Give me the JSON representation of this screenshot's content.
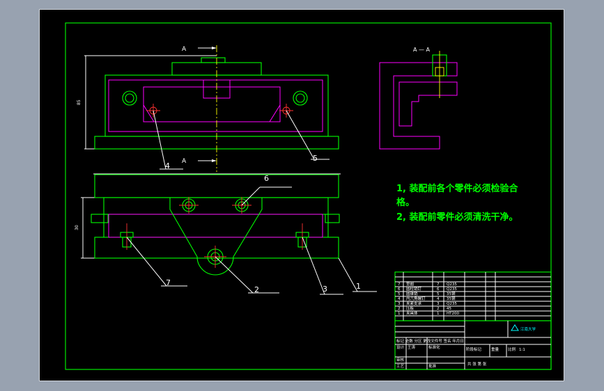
{
  "section_markers": {
    "top": "A",
    "bottom": "A"
  },
  "section_view_title": "A — A",
  "part_callouts": [
    "1",
    "2",
    "3",
    "4",
    "5",
    "6",
    "7"
  ],
  "dimension_labels": {
    "height_top": "85",
    "height_front": "30"
  },
  "technical_notes": [
    "1, 装配前各个零件必须检验合",
    "格。",
    "2, 装配前零件必须清洗干净。"
  ],
  "bom": {
    "rows": [
      {
        "no": "7",
        "name": "垫圈",
        "qty": "7",
        "material": "Q235"
      },
      {
        "no": "6",
        "name": "圆柱销钉",
        "qty": "6",
        "material": "Q235"
      },
      {
        "no": "5",
        "name": "圆锥销",
        "qty": "5",
        "material": "35钢"
      },
      {
        "no": "4",
        "name": "内六角螺钉",
        "qty": "4",
        "material": "35钢"
      },
      {
        "no": "3",
        "name": "夹紧支承",
        "qty": "3",
        "material": "Q235"
      },
      {
        "no": "2",
        "name": "压板",
        "qty": "2",
        "material": "45"
      },
      {
        "no": "1",
        "name": "夹具体",
        "qty": "1",
        "material": "HT200"
      }
    ]
  },
  "title_block": {
    "school": "江南大学",
    "header_row": "标记 处数 分区 更改文件号 签名 年月日",
    "design_label": "设计",
    "designer": "王涛",
    "standard_label": "标准化",
    "review_label": "审核",
    "process_label": "工艺",
    "approve_label": "批准",
    "stage_label": "阶段标记",
    "weight_label": "重量",
    "scale_label": "比例",
    "scale_value": "1:1",
    "sheet_label": "共 张 第 张"
  },
  "colors": {
    "outline": "#00ff00",
    "hidden": "#ff00ff",
    "centerline": "#ffff00",
    "text": "#ffffff",
    "hole_center": "#ff3030",
    "background": "#000000"
  }
}
